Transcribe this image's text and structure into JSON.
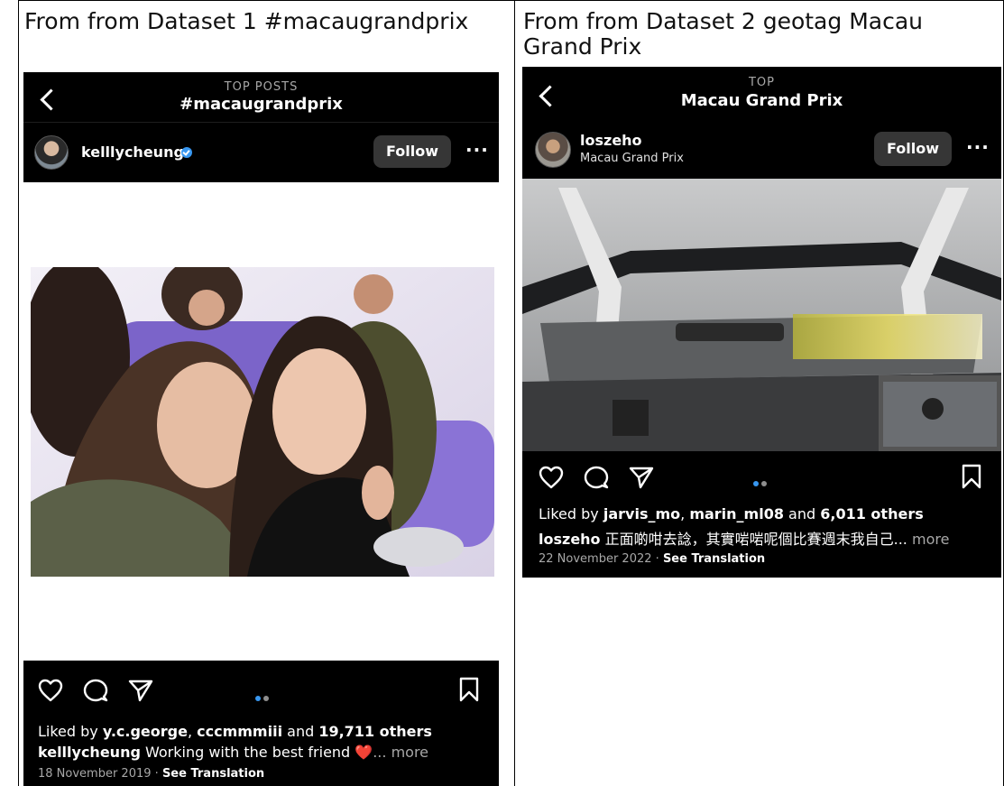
{
  "captions": {
    "left": "From from Dataset 1 #macaugrandprix",
    "right": "From from Dataset 2 geotag Macau Grand Prix"
  },
  "post1": {
    "header_small": "TOP POSTS",
    "header_big": "#macaugrandprix",
    "username": "kelllycheung",
    "verified": true,
    "follow_label": "Follow",
    "more_label": "···",
    "liked_prefix": "Liked by ",
    "liked_user1": "y.c.george",
    "liked_sep": ", ",
    "liked_user2": "cccmmmiii",
    "liked_and": " and ",
    "liked_count": "19,711 others",
    "caption_user": "kelllycheung",
    "caption_text": " Working with the best friend ",
    "caption_emoji": "❤️",
    "caption_more": "... more",
    "date": "18 November 2019",
    "date_sep": " · ",
    "see_translation": "See Translation"
  },
  "post2": {
    "header_small": "TOP",
    "header_big": "Macau Grand Prix",
    "username": "loszeho",
    "location": "Macau Grand Prix",
    "follow_label": "Follow",
    "more_label": "···",
    "liked_prefix": "Liked by ",
    "liked_user1": "jarvis_mo",
    "liked_sep": ", ",
    "liked_user2": "marin_ml08",
    "liked_and": " and ",
    "liked_count": "6,011 others",
    "caption_user": "loszeho",
    "caption_text": " 正面啲咁去諗，其實啱啱呢個比賽週末我自己...",
    "caption_more": " more",
    "date": "22 November 2022",
    "date_sep": " · ",
    "see_translation": "See Translation"
  },
  "colors": {
    "ig_black": "#000000",
    "follow_bg": "#363636",
    "verified_blue": "#3897f0",
    "pager_active": "#3897f0",
    "pager_inactive": "#8e8e8e",
    "muted_text": "#a8a8a8"
  },
  "icons": [
    "back-chevron-icon",
    "heart-icon",
    "comment-icon",
    "share-icon",
    "bookmark-icon",
    "more-dots-icon",
    "verified-icon"
  ]
}
